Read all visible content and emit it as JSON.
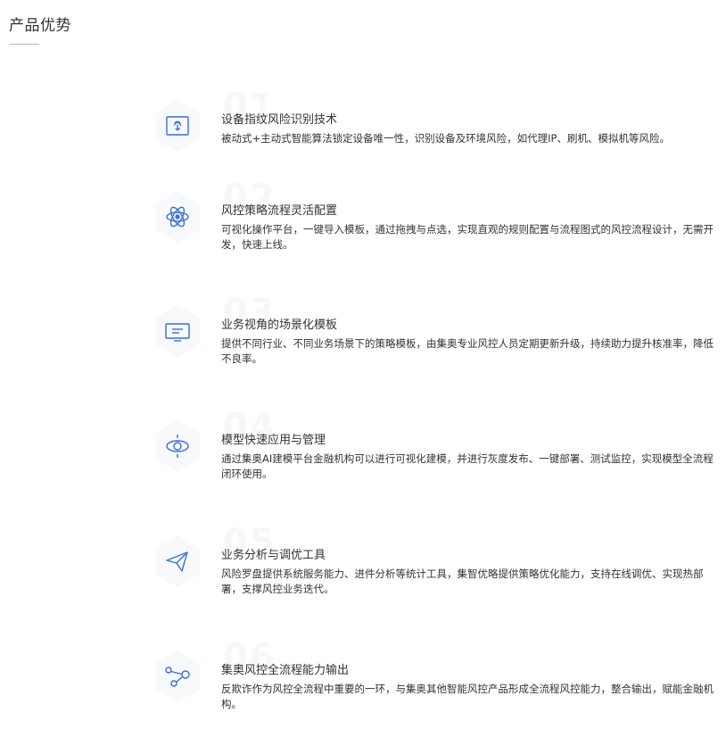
{
  "header": {
    "title": "产品优势"
  },
  "colors": {
    "accent": "#3a6fd8",
    "hex_bg": "#f7f9fc",
    "number": "#f5f7fa",
    "text": "#333333"
  },
  "features": [
    {
      "number": "01",
      "icon": "fingerprint-icon",
      "title": "设备指纹风险识别技术",
      "description": "被动式+主动式智能算法锁定设备唯一性，识别设备及环境风险，如代理IP、刷机、模拟机等风险。"
    },
    {
      "number": "02",
      "icon": "atom-icon",
      "title": "风控策略流程灵活配置",
      "description": "可视化操作平台，一键导入模板，通过拖拽与点选，实现直观的规则配置与流程图式的风控流程设计，无需开发，快速上线。"
    },
    {
      "number": "03",
      "icon": "monitor-icon",
      "title": "业务视角的场景化模板",
      "description": "提供不同行业、不同业务场景下的策略模板，由集奥专业风控人员定期更新升级，持续助力提升核准率，降低不良率。"
    },
    {
      "number": "04",
      "icon": "orbit-icon",
      "title": "模型快速应用与管理",
      "description": "通过集奥AI建模平台金融机构可以进行可视化建模，并进行灰度发布、一键部署、测试监控，实现模型全流程闭环使用。"
    },
    {
      "number": "05",
      "icon": "paper-plane-icon",
      "title": "业务分析与调优工具",
      "description": "风险罗盘提供系统服务能力、进件分析等统计工具，集智优略提供策略优化能力，支持在线调优、实现热部署，支撑风控业务迭代。"
    },
    {
      "number": "06",
      "icon": "share-nodes-icon",
      "title": "集奥风控全流程能力输出",
      "description": "反欺诈作为风控全流程中重要的一环，与集奥其他智能风控产品形成全流程风控能力，整合输出，赋能金融机构。"
    }
  ]
}
